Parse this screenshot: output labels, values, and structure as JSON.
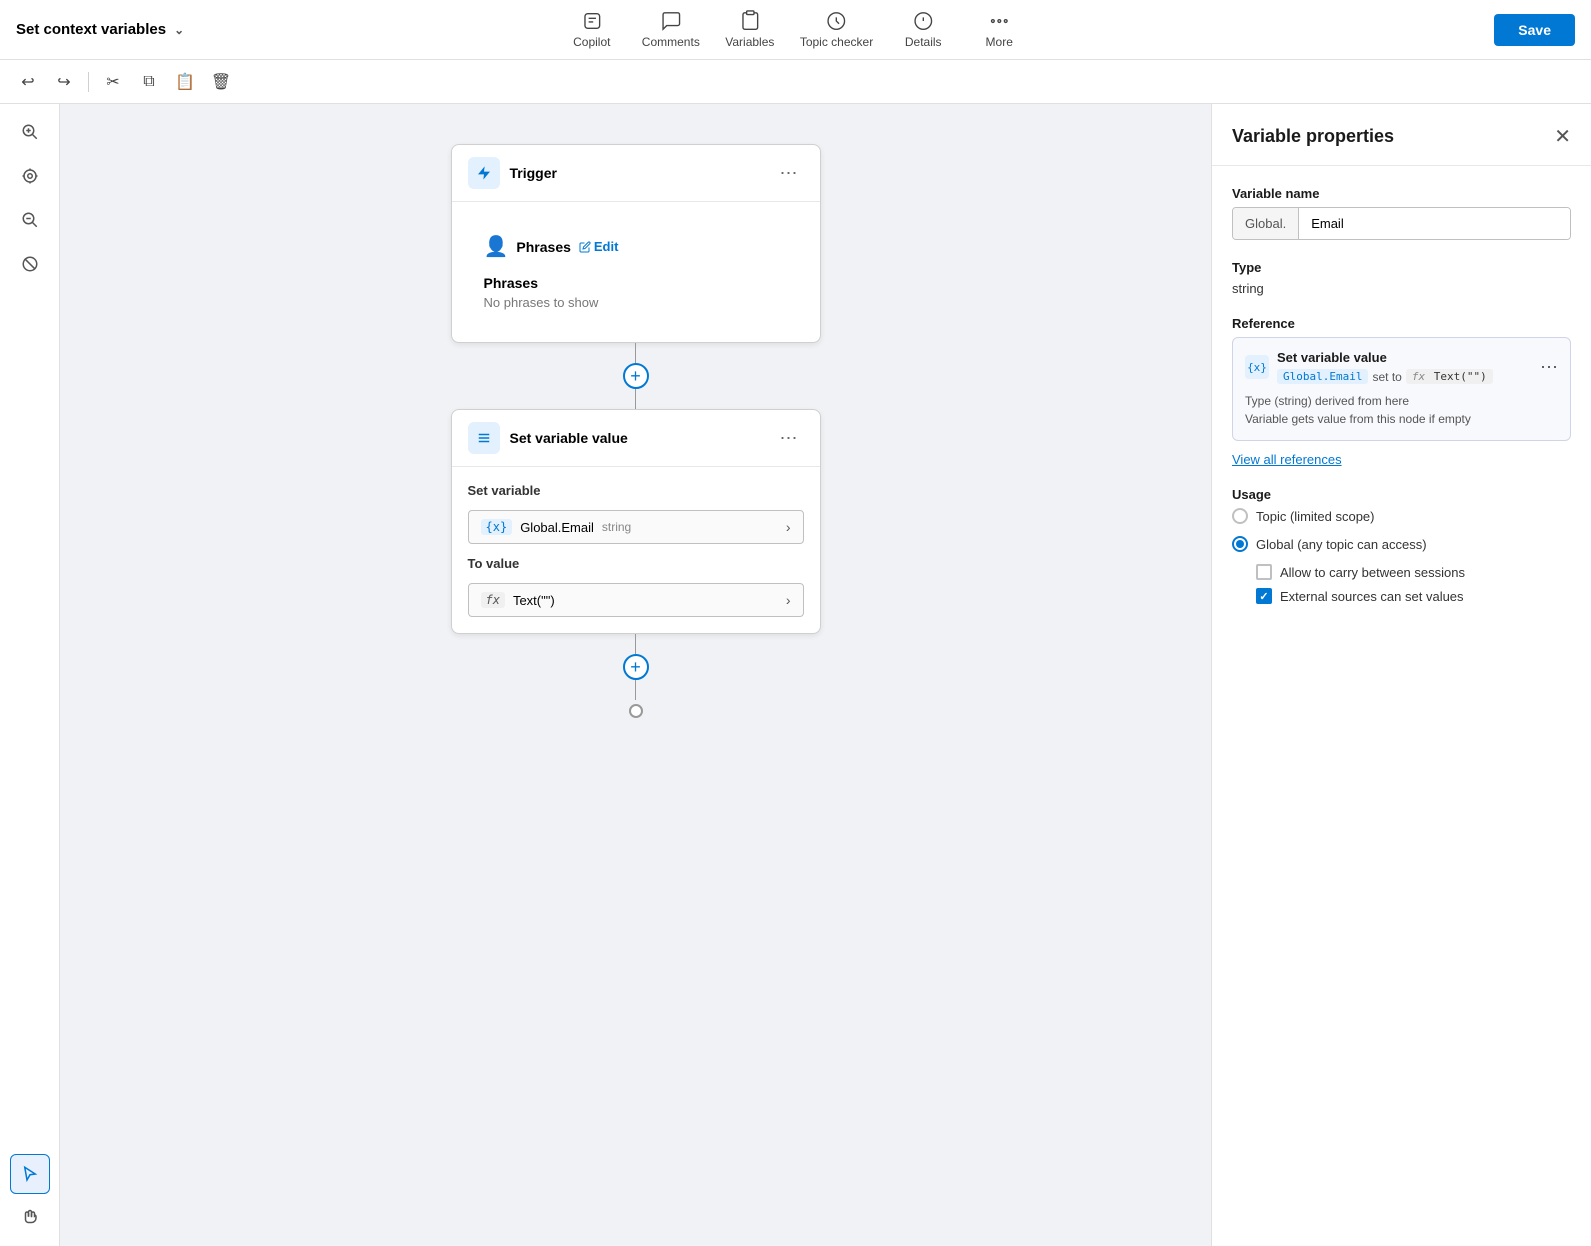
{
  "topbar": {
    "title": "Set context variables",
    "nav": [
      {
        "id": "copilot",
        "label": "Copilot",
        "icon": "copilot"
      },
      {
        "id": "comments",
        "label": "Comments",
        "icon": "comments"
      },
      {
        "id": "variables",
        "label": "Variables",
        "icon": "variables"
      },
      {
        "id": "topic_checker",
        "label": "Topic checker",
        "icon": "topic_checker"
      },
      {
        "id": "details",
        "label": "Details",
        "icon": "details"
      },
      {
        "id": "more",
        "label": "More",
        "icon": "more"
      }
    ],
    "save_label": "Save"
  },
  "toolbar": {
    "buttons": [
      "undo",
      "redo",
      "cut",
      "copy",
      "paste",
      "delete"
    ]
  },
  "canvas": {
    "trigger_node": {
      "title": "Trigger",
      "phrases_header": "Phrases",
      "edit_label": "Edit",
      "empty_label": "No phrases to show"
    },
    "set_variable_node": {
      "title": "Set variable value",
      "set_variable_label": "Set variable",
      "variable_name": "Global.Email",
      "variable_type": "string",
      "to_value_label": "To value",
      "to_value": "Text(\"\")"
    }
  },
  "right_panel": {
    "title": "Variable properties",
    "variable_name_label": "Variable name",
    "variable_prefix": "Global.",
    "variable_name_value": "Email",
    "type_label": "Type",
    "type_value": "string",
    "reference_label": "Reference",
    "ref_item": {
      "title": "Set variable value",
      "var": "Global.Email",
      "set_to": "set to",
      "fx": "Text(\"\")",
      "note_line1": "Type (string) derived from here",
      "note_line2": "Variable gets value from this node if empty"
    },
    "view_refs_label": "View all references",
    "usage_label": "Usage",
    "usage_options": [
      {
        "id": "topic",
        "label": "Topic (limited scope)",
        "checked": false
      },
      {
        "id": "global",
        "label": "Global (any topic can access)",
        "checked": true
      }
    ],
    "checkboxes": [
      {
        "id": "carry",
        "label": "Allow to carry between sessions",
        "checked": false
      },
      {
        "id": "external",
        "label": "External sources can set values",
        "checked": true
      }
    ]
  }
}
